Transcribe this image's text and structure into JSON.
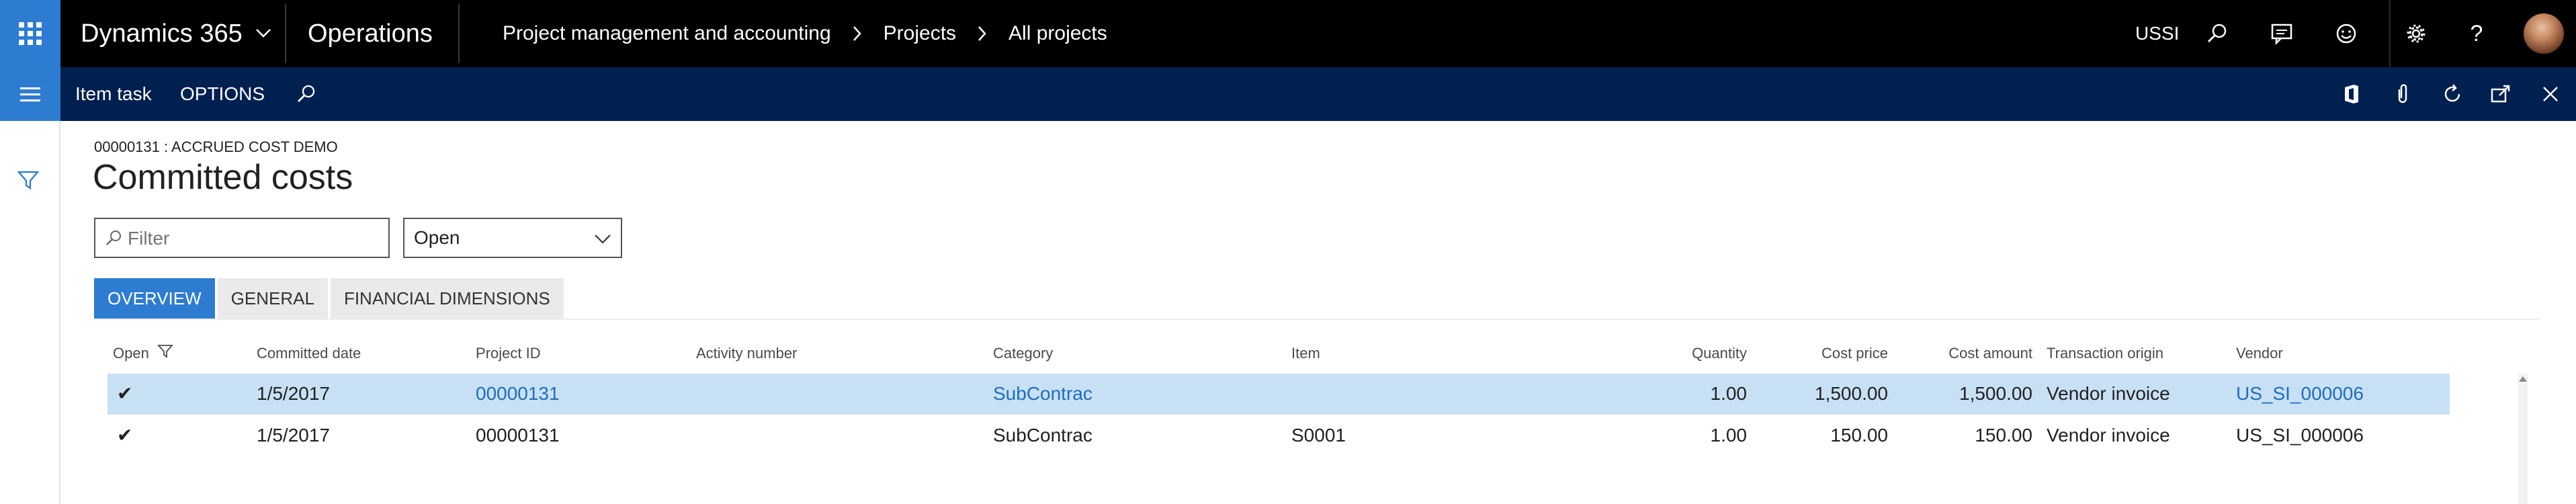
{
  "topbar": {
    "app_name": "Dynamics 365",
    "module": "Operations",
    "breadcrumb": [
      "Project management and accounting",
      "Projects",
      "All projects"
    ],
    "company": "USSI",
    "icons": [
      "app-launcher-icon",
      "search-icon",
      "feedback-icon",
      "smiley-icon",
      "gear-icon",
      "help-icon"
    ]
  },
  "actionbar": {
    "item_task": "Item task",
    "options": "OPTIONS",
    "right_icons": [
      "office-icon",
      "attachment-icon",
      "refresh-icon",
      "open-new-window-icon",
      "close-icon"
    ]
  },
  "page": {
    "record_caption": "00000131 : ACCRUED COST DEMO",
    "title": "Committed costs",
    "filter_placeholder": "Filter",
    "status_value": "Open"
  },
  "tabs": [
    {
      "label": "OVERVIEW",
      "active": true
    },
    {
      "label": "GENERAL",
      "active": false
    },
    {
      "label": "FINANCIAL DIMENSIONS",
      "active": false
    }
  ],
  "grid": {
    "columns": {
      "open": "Open",
      "committed_date": "Committed date",
      "project_id": "Project ID",
      "activity_number": "Activity number",
      "category": "Category",
      "item": "Item",
      "quantity": "Quantity",
      "cost_price": "Cost price",
      "cost_amount": "Cost amount",
      "transaction_origin": "Transaction origin",
      "vendor": "Vendor"
    },
    "rows": [
      {
        "open": "✔",
        "committed_date": "1/5/2017",
        "project_id": "00000131",
        "activity_number": "",
        "category": "SubContrac",
        "item": "",
        "quantity": "1.00",
        "cost_price": "1,500.00",
        "cost_amount": "1,500.00",
        "transaction_origin": "Vendor invoice",
        "vendor": "US_SI_000006"
      },
      {
        "open": "✔",
        "committed_date": "1/5/2017",
        "project_id": "00000131",
        "activity_number": "",
        "category": "SubContrac",
        "item": "S0001",
        "quantity": "1.00",
        "cost_price": "150.00",
        "cost_amount": "150.00",
        "transaction_origin": "Vendor invoice",
        "vendor": "US_SI_000006"
      }
    ]
  },
  "colors": {
    "accent": "#2d7cd1",
    "navbar": "#000000",
    "actionbar": "#002050",
    "selected_row": "#c7e0f4",
    "link": "#1f6dbd"
  }
}
